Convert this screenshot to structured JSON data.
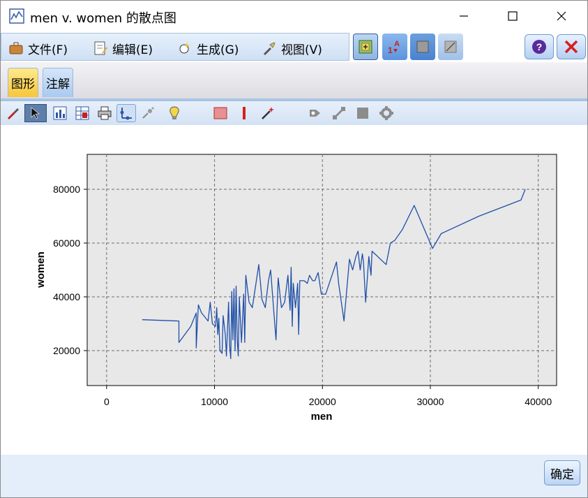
{
  "window": {
    "title": "men v. women 的散点图",
    "app_icon": "line-chart-icon"
  },
  "title_controls": {
    "minimize_icon": "minimize-icon",
    "maximize_icon": "maximize-icon",
    "close_icon": "close-icon"
  },
  "menubar": {
    "items": [
      {
        "label": "文件(F)",
        "icon": "briefcase-icon"
      },
      {
        "label": "编辑(E)",
        "icon": "edit-document-icon"
      },
      {
        "label": "生成(G)",
        "icon": "generate-sparkle-icon"
      },
      {
        "label": "视图(V)",
        "icon": "flashlight-icon"
      }
    ]
  },
  "toolbar_right": {
    "items": [
      "add-graph-icon",
      "sort-axis-icon",
      "frame-icon",
      "line-frame-icon"
    ],
    "help_icon": "help-icon",
    "close_icon": "red-x-icon"
  },
  "tabs": [
    {
      "label": "图形",
      "active": true
    },
    {
      "label": "注解",
      "active": false
    }
  ],
  "chart_toolbar": {
    "icons": [
      "brush-icon",
      "pointer-icon",
      "bar-chart-icon",
      "table-icon",
      "print-icon",
      "axis-icon",
      "scatter-icon",
      "lightbulb-icon",
      "red-square-icon",
      "red-line-icon",
      "magic-wand-icon",
      "node-icon",
      "diagonal-icon",
      "square-icon",
      "gear-icon"
    ]
  },
  "colors": {
    "accent": "#1f4fa8",
    "plot_background": "#e8e8e8",
    "tab_active": "#f7c63a",
    "tab_inactive": "#a9c9ef",
    "footer": "#e4eefa"
  },
  "chart_data": {
    "type": "line",
    "title": "",
    "xlabel": "men",
    "ylabel": "women",
    "xlim": [
      -1800,
      41700
    ],
    "ylim": [
      7000,
      93000
    ],
    "x_ticks": [
      0,
      10000,
      20000,
      30000,
      40000
    ],
    "y_ticks": [
      20000,
      40000,
      60000,
      80000
    ],
    "x_tick_labels": [
      "0",
      "10000",
      "20000",
      "30000",
      "40000"
    ],
    "y_tick_labels": [
      "20000",
      "40000",
      "60000",
      "80000"
    ],
    "grid": true,
    "series": [
      {
        "name": "",
        "points": [
          [
            3300,
            31500
          ],
          [
            6700,
            31000
          ],
          [
            6700,
            23000
          ],
          [
            7800,
            29000
          ],
          [
            8300,
            34000
          ],
          [
            8300,
            21000
          ],
          [
            8500,
            37000
          ],
          [
            8800,
            34000
          ],
          [
            9000,
            33000
          ],
          [
            9400,
            31000
          ],
          [
            9600,
            38000
          ],
          [
            9800,
            30000
          ],
          [
            10100,
            29000
          ],
          [
            10200,
            36000
          ],
          [
            10300,
            26000
          ],
          [
            10400,
            32000
          ],
          [
            10500,
            20000
          ],
          [
            10700,
            19000
          ],
          [
            10800,
            33000
          ],
          [
            11000,
            26000
          ],
          [
            11100,
            18000
          ],
          [
            11300,
            38000
          ],
          [
            11400,
            22000
          ],
          [
            11500,
            17000
          ],
          [
            11600,
            42000
          ],
          [
            11700,
            24000
          ],
          [
            11800,
            43000
          ],
          [
            11900,
            20000
          ],
          [
            12000,
            44000
          ],
          [
            12100,
            24000
          ],
          [
            12200,
            18000
          ],
          [
            12300,
            40000
          ],
          [
            12500,
            23000
          ],
          [
            12700,
            41000
          ],
          [
            12800,
            23000
          ],
          [
            12900,
            48000
          ],
          [
            13200,
            38000
          ],
          [
            13500,
            36000
          ],
          [
            13800,
            44000
          ],
          [
            14100,
            52000
          ],
          [
            14400,
            39000
          ],
          [
            14700,
            36000
          ],
          [
            15000,
            46000
          ],
          [
            15200,
            50000
          ],
          [
            15500,
            34000
          ],
          [
            15700,
            24000
          ],
          [
            15900,
            47000
          ],
          [
            16200,
            36000
          ],
          [
            16500,
            38000
          ],
          [
            16800,
            48000
          ],
          [
            17000,
            35000
          ],
          [
            17100,
            51000
          ],
          [
            17200,
            29000
          ],
          [
            17300,
            45000
          ],
          [
            17500,
            36000
          ],
          [
            17700,
            45000
          ],
          [
            17800,
            26000
          ],
          [
            17900,
            46000
          ],
          [
            18300,
            46000
          ],
          [
            18600,
            45000
          ],
          [
            18800,
            48000
          ],
          [
            19100,
            46000
          ],
          [
            19300,
            46000
          ],
          [
            19600,
            49000
          ],
          [
            19900,
            41000
          ],
          [
            20300,
            41000
          ],
          [
            21300,
            53000
          ],
          [
            21500,
            45000
          ],
          [
            22000,
            31000
          ],
          [
            22500,
            54000
          ],
          [
            22800,
            50000
          ],
          [
            23100,
            55000
          ],
          [
            23300,
            57000
          ],
          [
            23500,
            50000
          ],
          [
            23700,
            56000
          ],
          [
            23800,
            53000
          ],
          [
            24000,
            38000
          ],
          [
            24300,
            55000
          ],
          [
            24500,
            48000
          ],
          [
            24600,
            57000
          ],
          [
            25900,
            52000
          ],
          [
            26300,
            60000
          ],
          [
            26700,
            61000
          ],
          [
            27400,
            65000
          ],
          [
            28500,
            74000
          ],
          [
            30200,
            58000
          ],
          [
            31000,
            63500
          ],
          [
            34500,
            70000
          ],
          [
            38400,
            76000
          ],
          [
            38800,
            80000
          ]
        ]
      }
    ]
  },
  "footer": {
    "ok_label": "确定"
  }
}
